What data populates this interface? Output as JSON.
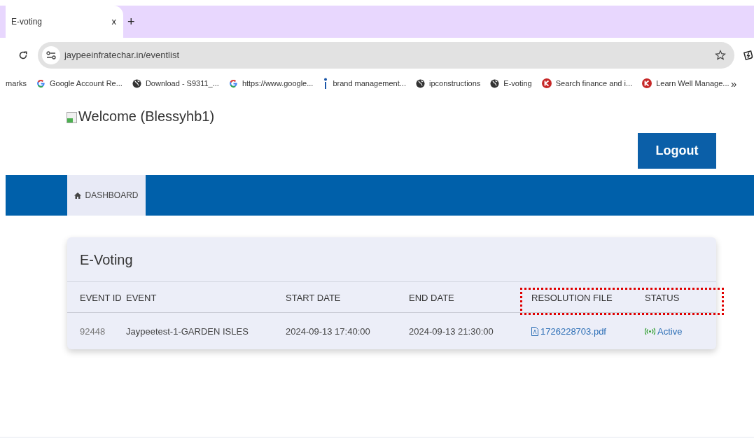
{
  "browser": {
    "tab_title": "E-voting",
    "tab_close": "x",
    "new_tab": "+",
    "url": "jaypeeinfratechar.in/eventlist",
    "bookmarks": [
      {
        "kind": "plain",
        "label": "marks"
      },
      {
        "kind": "google",
        "label": "Google Account Re..."
      },
      {
        "kind": "globe",
        "label": "Download - S9311_..."
      },
      {
        "kind": "google",
        "label": "https://www.google..."
      },
      {
        "kind": "pin",
        "label": "brand management..."
      },
      {
        "kind": "globe",
        "label": "ipconstructions"
      },
      {
        "kind": "globe",
        "label": "E-voting"
      },
      {
        "kind": "k",
        "label": "Search finance and i..."
      },
      {
        "kind": "k",
        "label": "Learn Well Manage..."
      }
    ],
    "more": "»"
  },
  "page": {
    "welcome": "Welcome (Blessyhb1)",
    "logout": "Logout",
    "nav": [
      {
        "label": "DASHBOARD",
        "selected": true
      }
    ],
    "card": {
      "title": "E-Voting",
      "columns": [
        "EVENT ID",
        "EVENT",
        "START DATE",
        "END DATE",
        "RESOLUTION FILE",
        "STATUS"
      ],
      "rows": [
        {
          "event_id": "92448",
          "event": "Jaypeetest-1-GARDEN ISLES",
          "start_date": "2024-09-13 17:40:00",
          "end_date": "2024-09-13 21:30:00",
          "resolution_file": "1726228703.pdf",
          "status": "Active"
        }
      ]
    }
  }
}
